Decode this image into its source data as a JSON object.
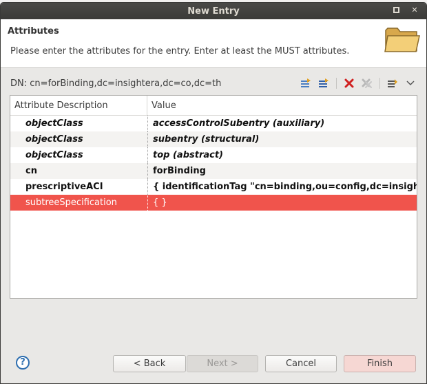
{
  "window": {
    "title": "New Entry"
  },
  "header": {
    "title": "Attributes",
    "description": "Please enter the attributes for the entry. Enter at least the MUST attributes."
  },
  "dn": {
    "label": "DN: cn=forBinding,dc=insightera,dc=co,dc=th"
  },
  "toolbar": {
    "icons": [
      "new-attribute-icon",
      "new-value-icon",
      "delete-icon",
      "delete-all-icon",
      "sort-icon",
      "view-menu-icon"
    ]
  },
  "table": {
    "headers": [
      "Attribute Description",
      "Value"
    ],
    "rows": [
      {
        "attr": "objectClass",
        "value": "accessControlSubentry (auxiliary)"
      },
      {
        "attr": "objectClass",
        "value": "subentry (structural)"
      },
      {
        "attr": "objectClass",
        "value": "top (abstract)"
      },
      {
        "attr": "cn",
        "value": "forBinding"
      },
      {
        "attr": "prescriptiveACI",
        "value": "{ identificationTag \"cn=binding,ou=config,dc=insighter"
      },
      {
        "attr": "subtreeSpecification",
        "value": "{ }"
      }
    ]
  },
  "buttons": {
    "help": "?",
    "back": "< Back",
    "next": "Next >",
    "cancel": "Cancel",
    "finish": "Finish"
  },
  "colors": {
    "selected_row": "#f0544c",
    "titlebar": "#3b3b38"
  }
}
